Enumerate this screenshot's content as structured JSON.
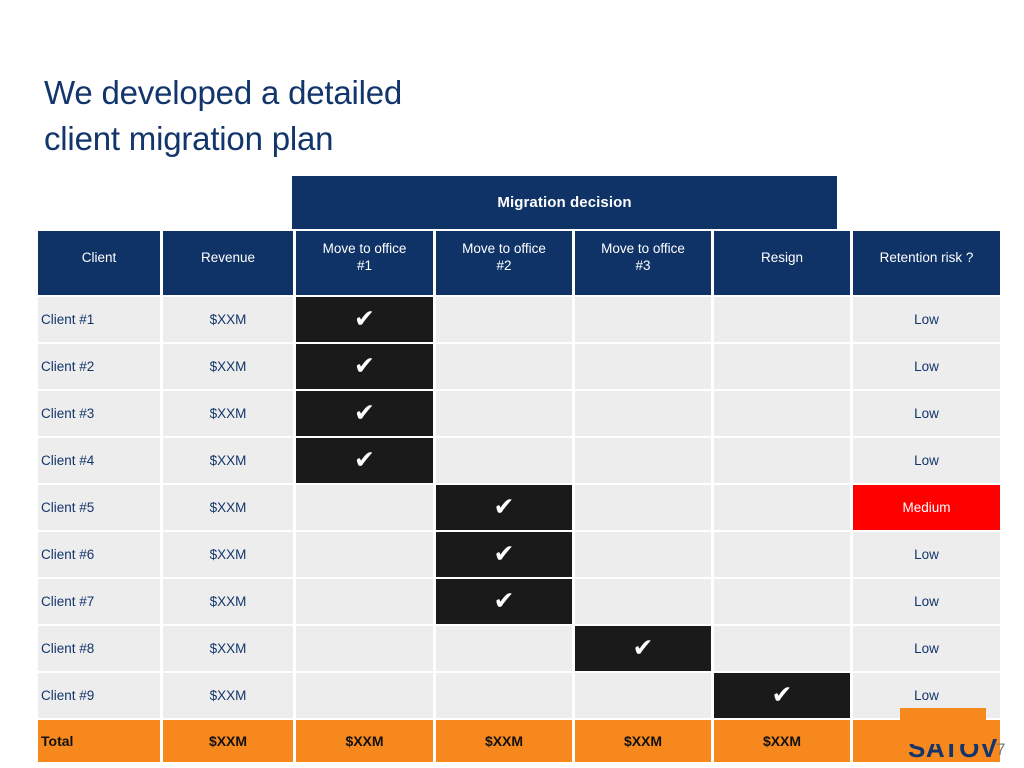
{
  "slide": {
    "title_lines": [
      "We developed a detailed",
      "client migration plan"
    ],
    "page_number": "7",
    "logo_text": "SATOV",
    "colors": {
      "header_blue": "#0F3366",
      "title_blue": "#12356B",
      "row_gray": "#EDEDED",
      "mark_black": "#1A1A1A",
      "total_orange": "#F7881E",
      "risk_medium_red": "#FF0000"
    }
  },
  "table": {
    "group_header": {
      "label": "Migration decision",
      "spans_columns": [
        "Move to office #1",
        "Move to office #2",
        "Move to office #3",
        "Resign"
      ]
    },
    "columns": [
      {
        "key": "client",
        "label": "Client"
      },
      {
        "key": "revenue",
        "label": "Revenue"
      },
      {
        "key": "office1",
        "label": "Move to office\n#1",
        "label_l1": "Move to office",
        "label_l2": "#1"
      },
      {
        "key": "office2",
        "label": "Move to office\n#2",
        "label_l1": "Move to office",
        "label_l2": "#2"
      },
      {
        "key": "office3",
        "label": "Move to office\n#3",
        "label_l1": "Move to office",
        "label_l2": "#3"
      },
      {
        "key": "resign",
        "label": "Resign"
      },
      {
        "key": "risk",
        "label": "Retention risk ?"
      }
    ],
    "check_glyph": "✔",
    "rows": [
      {
        "client": "Client #1",
        "revenue": "$XXM",
        "office1": true,
        "office2": false,
        "office3": false,
        "resign": false,
        "risk": "Low",
        "risk_level": "low"
      },
      {
        "client": "Client #2",
        "revenue": "$XXM",
        "office1": true,
        "office2": false,
        "office3": false,
        "resign": false,
        "risk": "Low",
        "risk_level": "low"
      },
      {
        "client": "Client #3",
        "revenue": "$XXM",
        "office1": true,
        "office2": false,
        "office3": false,
        "resign": false,
        "risk": "Low",
        "risk_level": "low"
      },
      {
        "client": "Client #4",
        "revenue": "$XXM",
        "office1": true,
        "office2": false,
        "office3": false,
        "resign": false,
        "risk": "Low",
        "risk_level": "low"
      },
      {
        "client": "Client #5",
        "revenue": "$XXM",
        "office1": false,
        "office2": true,
        "office3": false,
        "resign": false,
        "risk": "Medium",
        "risk_level": "medium"
      },
      {
        "client": "Client #6",
        "revenue": "$XXM",
        "office1": false,
        "office2": true,
        "office3": false,
        "resign": false,
        "risk": "Low",
        "risk_level": "low"
      },
      {
        "client": "Client #7",
        "revenue": "$XXM",
        "office1": false,
        "office2": true,
        "office3": false,
        "resign": false,
        "risk": "Low",
        "risk_level": "low"
      },
      {
        "client": "Client #8",
        "revenue": "$XXM",
        "office1": false,
        "office2": false,
        "office3": true,
        "resign": false,
        "risk": "Low",
        "risk_level": "low"
      },
      {
        "client": "Client #9",
        "revenue": "$XXM",
        "office1": false,
        "office2": false,
        "office3": false,
        "resign": true,
        "risk": "Low",
        "risk_level": "low"
      }
    ],
    "total_row": {
      "client": "Total",
      "revenue": "$XXM",
      "office1": "$XXM",
      "office2": "$XXM",
      "office3": "$XXM",
      "resign": "$XXM",
      "risk": ""
    }
  }
}
